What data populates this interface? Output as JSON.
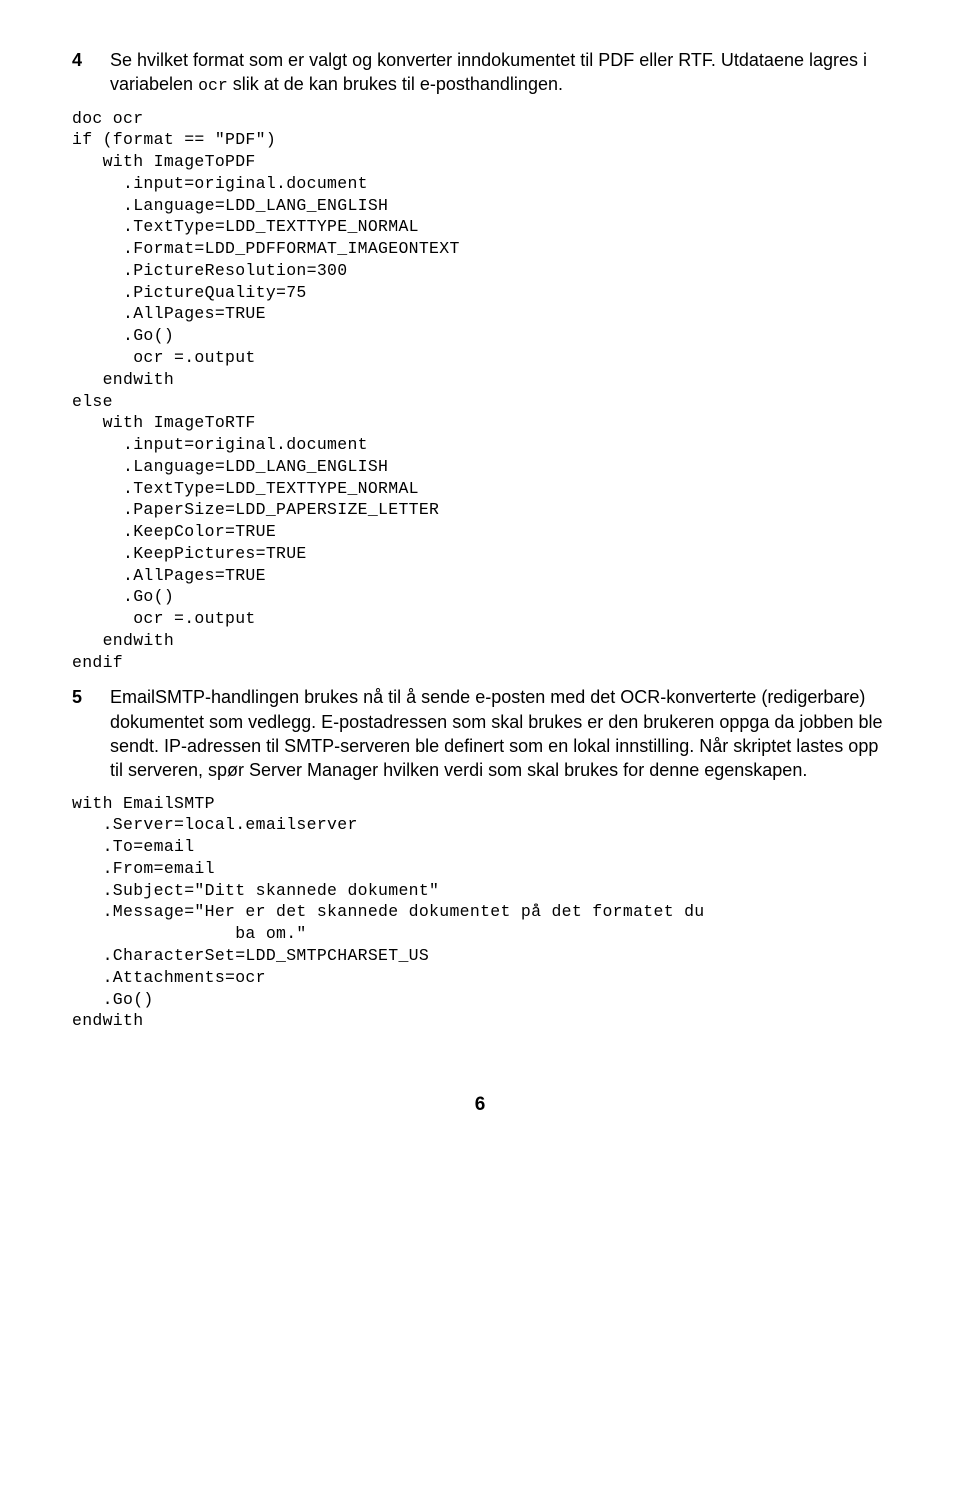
{
  "steps": {
    "s4": {
      "num": "4",
      "text_pre": "Se hvilket format som er valgt og konverter inndokumentet til PDF eller RTF. Utdataene lagres i variabelen ",
      "code_inline": "ocr",
      "text_post": " slik at de kan brukes til e-posthandlingen."
    },
    "code1": "doc ocr\nif (format == \"PDF\")\n   with ImageToPDF\n     .input=original.document\n     .Language=LDD_LANG_ENGLISH\n     .TextType=LDD_TEXTTYPE_NORMAL\n     .Format=LDD_PDFFORMAT_IMAGEONTEXT\n     .PictureResolution=300\n     .PictureQuality=75\n     .AllPages=TRUE\n     .Go()\n      ocr =.output\n   endwith\nelse\n   with ImageToRTF\n     .input=original.document\n     .Language=LDD_LANG_ENGLISH\n     .TextType=LDD_TEXTTYPE_NORMAL\n     .PaperSize=LDD_PAPERSIZE_LETTER\n     .KeepColor=TRUE\n     .KeepPictures=TRUE\n     .AllPages=TRUE\n     .Go()\n      ocr =.output\n   endwith\nendif",
    "s5": {
      "num": "5",
      "text": "EmailSMTP-handlingen brukes nå til å sende e-posten med det OCR-konverterte (redigerbare) dokumentet som vedlegg. E-postadressen som skal brukes er den brukeren oppga da jobben ble sendt. IP-adressen til SMTP-serveren ble definert som en lokal innstilling. Når skriptet lastes opp til serveren, spør Server Manager hvilken verdi som skal brukes for denne egenskapen."
    },
    "code2": "with EmailSMTP\n   .Server=local.emailserver\n   .To=email\n   .From=email\n   .Subject=\"Ditt skannede dokument\"\n   .Message=\"Her er det skannede dokumentet på det formatet du\n                ba om.\"\n   .CharacterSet=LDD_SMTPCHARSET_US\n   .Attachments=ocr\n   .Go()\nendwith"
  },
  "page_number": "6"
}
